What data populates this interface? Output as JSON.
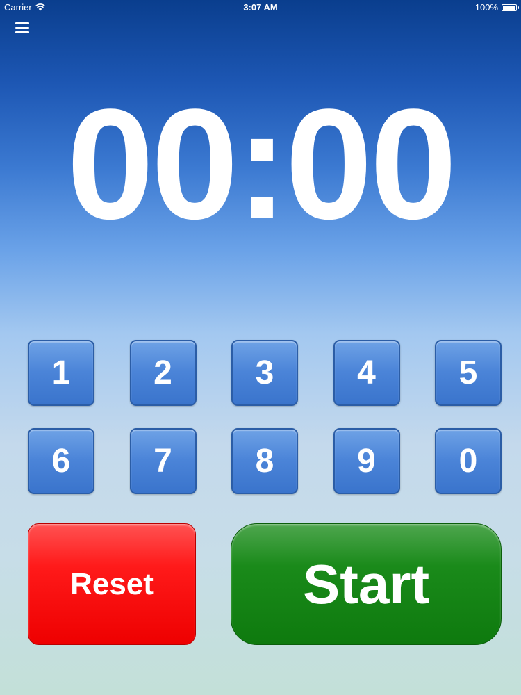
{
  "status_bar": {
    "carrier": "Carrier",
    "time": "3:07 AM",
    "battery": "100%",
    "battery_level": 1.0
  },
  "menu": {
    "icon": "hamburger-menu-icon"
  },
  "timer": {
    "display": "00:00"
  },
  "keypad": {
    "rows": [
      [
        "1",
        "2",
        "3",
        "4",
        "5"
      ],
      [
        "6",
        "7",
        "8",
        "9",
        "0"
      ]
    ]
  },
  "actions": {
    "reset_label": "Reset",
    "start_label": "Start"
  },
  "colors": {
    "background_top": "#0a3e8e",
    "background_bottom": "#c3e0d8",
    "key_blue": "#4b84d8",
    "reset_red": "#ff0000",
    "start_green": "#138a13",
    "text": "#ffffff"
  }
}
